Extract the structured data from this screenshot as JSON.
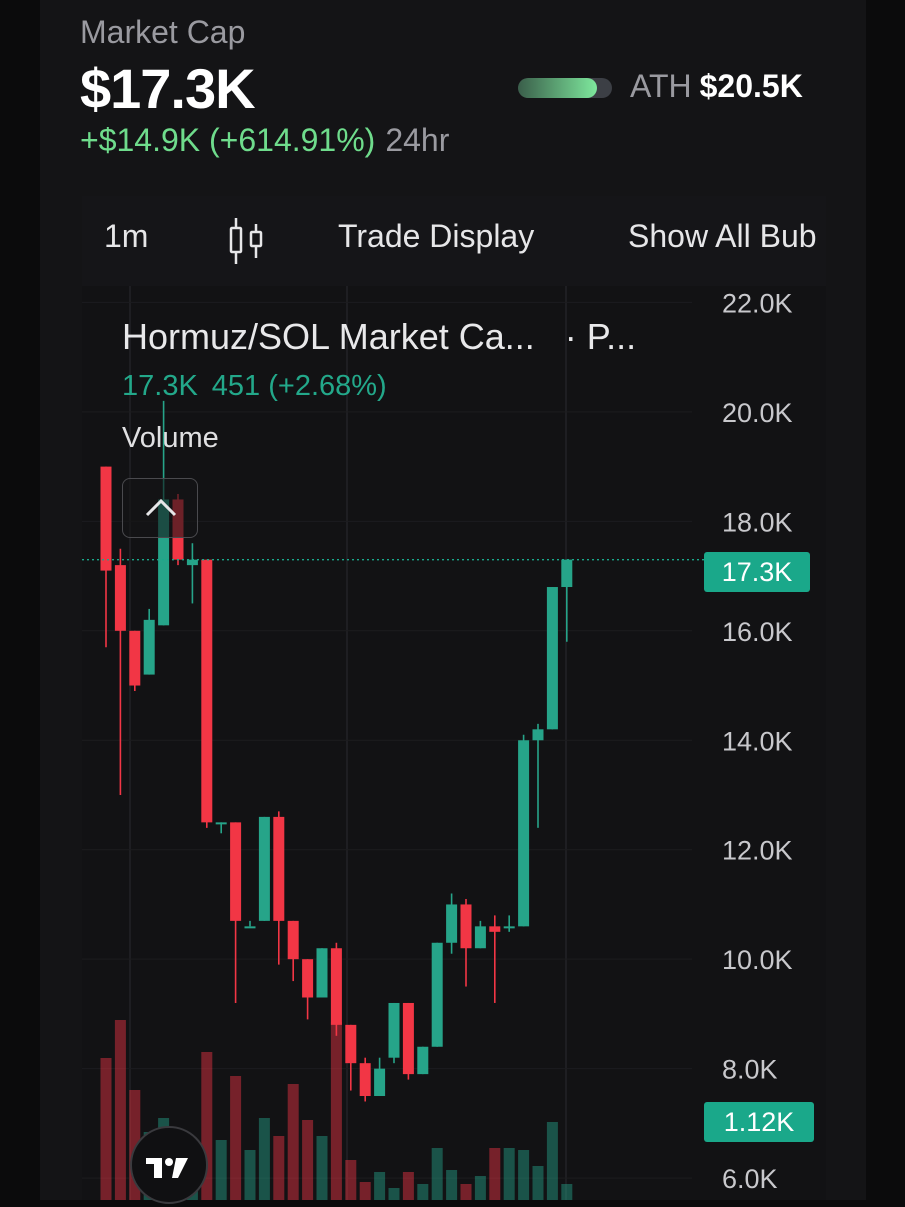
{
  "header": {
    "market_cap_label": "Market Cap",
    "market_cap_value": "$17.3K",
    "change": "+$14.9K (+614.91%)",
    "period": "24hr",
    "ath_label": "ATH",
    "ath_value": "$20.5K",
    "ath_progress": 0.84
  },
  "toolbar": {
    "interval": "1m",
    "chart_type_icon": "candlestick-icon",
    "trade_display": "Trade Display",
    "show_all": "Show All Bub"
  },
  "chart": {
    "title": "Hormuz/SOL Market Ca...",
    "title_suffix": "· P...",
    "ohlc_value": "17.3K",
    "ohlc_change": "451 (+2.68%)",
    "volume_label": "Volume",
    "price_badge": "17.3K",
    "volume_badge": "1.12K"
  },
  "colors": {
    "up": "#26a489",
    "down": "#f23645",
    "accent_green": "#6fdc8c",
    "badge": "#1aa88a"
  },
  "chart_data": {
    "type": "candlestick",
    "y_tick_labels": [
      "22.0K",
      "20.0K",
      "18.0K",
      "16.0K",
      "14.0K",
      "12.0K",
      "10.0K",
      "8.0K",
      "6.0K"
    ],
    "y_ticks": [
      22,
      20,
      18,
      16,
      14,
      12,
      10,
      8,
      6
    ],
    "ylim": [
      5.6,
      22.3
    ],
    "unit": "K",
    "candles": [
      {
        "o": 19.0,
        "h": 19.0,
        "l": 15.7,
        "c": 17.1
      },
      {
        "o": 17.2,
        "h": 17.5,
        "l": 13.0,
        "c": 16.0
      },
      {
        "o": 16.0,
        "h": 16.0,
        "l": 14.9,
        "c": 15.0
      },
      {
        "o": 15.2,
        "h": 16.4,
        "l": 15.2,
        "c": 16.2
      },
      {
        "o": 16.1,
        "h": 20.2,
        "l": 16.1,
        "c": 18.4
      },
      {
        "o": 18.4,
        "h": 18.5,
        "l": 17.2,
        "c": 17.3
      },
      {
        "o": 17.2,
        "h": 17.6,
        "l": 16.5,
        "c": 17.3
      },
      {
        "o": 17.3,
        "h": 17.3,
        "l": 12.4,
        "c": 12.5
      },
      {
        "o": 12.5,
        "h": 12.5,
        "l": 12.3,
        "c": 12.5
      },
      {
        "o": 12.5,
        "h": 12.5,
        "l": 9.2,
        "c": 10.7
      },
      {
        "o": 10.6,
        "h": 10.7,
        "l": 10.6,
        "c": 10.6
      },
      {
        "o": 10.7,
        "h": 12.6,
        "l": 10.7,
        "c": 12.6
      },
      {
        "o": 12.6,
        "h": 12.7,
        "l": 9.9,
        "c": 10.7
      },
      {
        "o": 10.7,
        "h": 10.7,
        "l": 9.6,
        "c": 10.0
      },
      {
        "o": 10.0,
        "h": 10.0,
        "l": 8.9,
        "c": 9.3
      },
      {
        "o": 9.3,
        "h": 10.2,
        "l": 9.3,
        "c": 10.2
      },
      {
        "o": 10.2,
        "h": 10.3,
        "l": 8.6,
        "c": 8.8
      },
      {
        "o": 8.8,
        "h": 8.8,
        "l": 7.6,
        "c": 8.1
      },
      {
        "o": 8.1,
        "h": 8.2,
        "l": 7.4,
        "c": 7.5
      },
      {
        "o": 7.5,
        "h": 8.2,
        "l": 7.5,
        "c": 8.0
      },
      {
        "o": 8.2,
        "h": 9.2,
        "l": 8.1,
        "c": 9.2
      },
      {
        "o": 9.2,
        "h": 9.2,
        "l": 7.8,
        "c": 7.9
      },
      {
        "o": 7.9,
        "h": 8.4,
        "l": 7.9,
        "c": 8.4
      },
      {
        "o": 8.4,
        "h": 10.3,
        "l": 8.4,
        "c": 10.3
      },
      {
        "o": 10.3,
        "h": 11.2,
        "l": 10.1,
        "c": 11.0
      },
      {
        "o": 11.0,
        "h": 11.1,
        "l": 9.5,
        "c": 10.2
      },
      {
        "o": 10.2,
        "h": 10.7,
        "l": 10.2,
        "c": 10.6
      },
      {
        "o": 10.6,
        "h": 10.8,
        "l": 9.2,
        "c": 10.5
      },
      {
        "o": 10.6,
        "h": 10.8,
        "l": 10.5,
        "c": 10.6
      },
      {
        "o": 10.6,
        "h": 14.1,
        "l": 10.6,
        "c": 14.0
      },
      {
        "o": 14.0,
        "h": 14.3,
        "l": 12.4,
        "c": 14.2
      },
      {
        "o": 14.2,
        "h": 16.8,
        "l": 14.2,
        "c": 16.8
      },
      {
        "o": 16.8,
        "h": 17.3,
        "l": 15.8,
        "c": 17.3
      }
    ],
    "volumes": [
      7.1,
      9.0,
      5.5,
      3.4,
      4.1,
      2.7,
      2.0,
      7.4,
      3.0,
      6.2,
      2.5,
      4.1,
      3.2,
      5.8,
      4.0,
      3.2,
      8.9,
      2.0,
      0.9,
      1.4,
      0.6,
      1.4,
      0.8,
      2.6,
      1.5,
      0.8,
      1.2,
      2.6,
      2.6,
      2.5,
      1.7,
      3.9,
      0.8
    ]
  }
}
